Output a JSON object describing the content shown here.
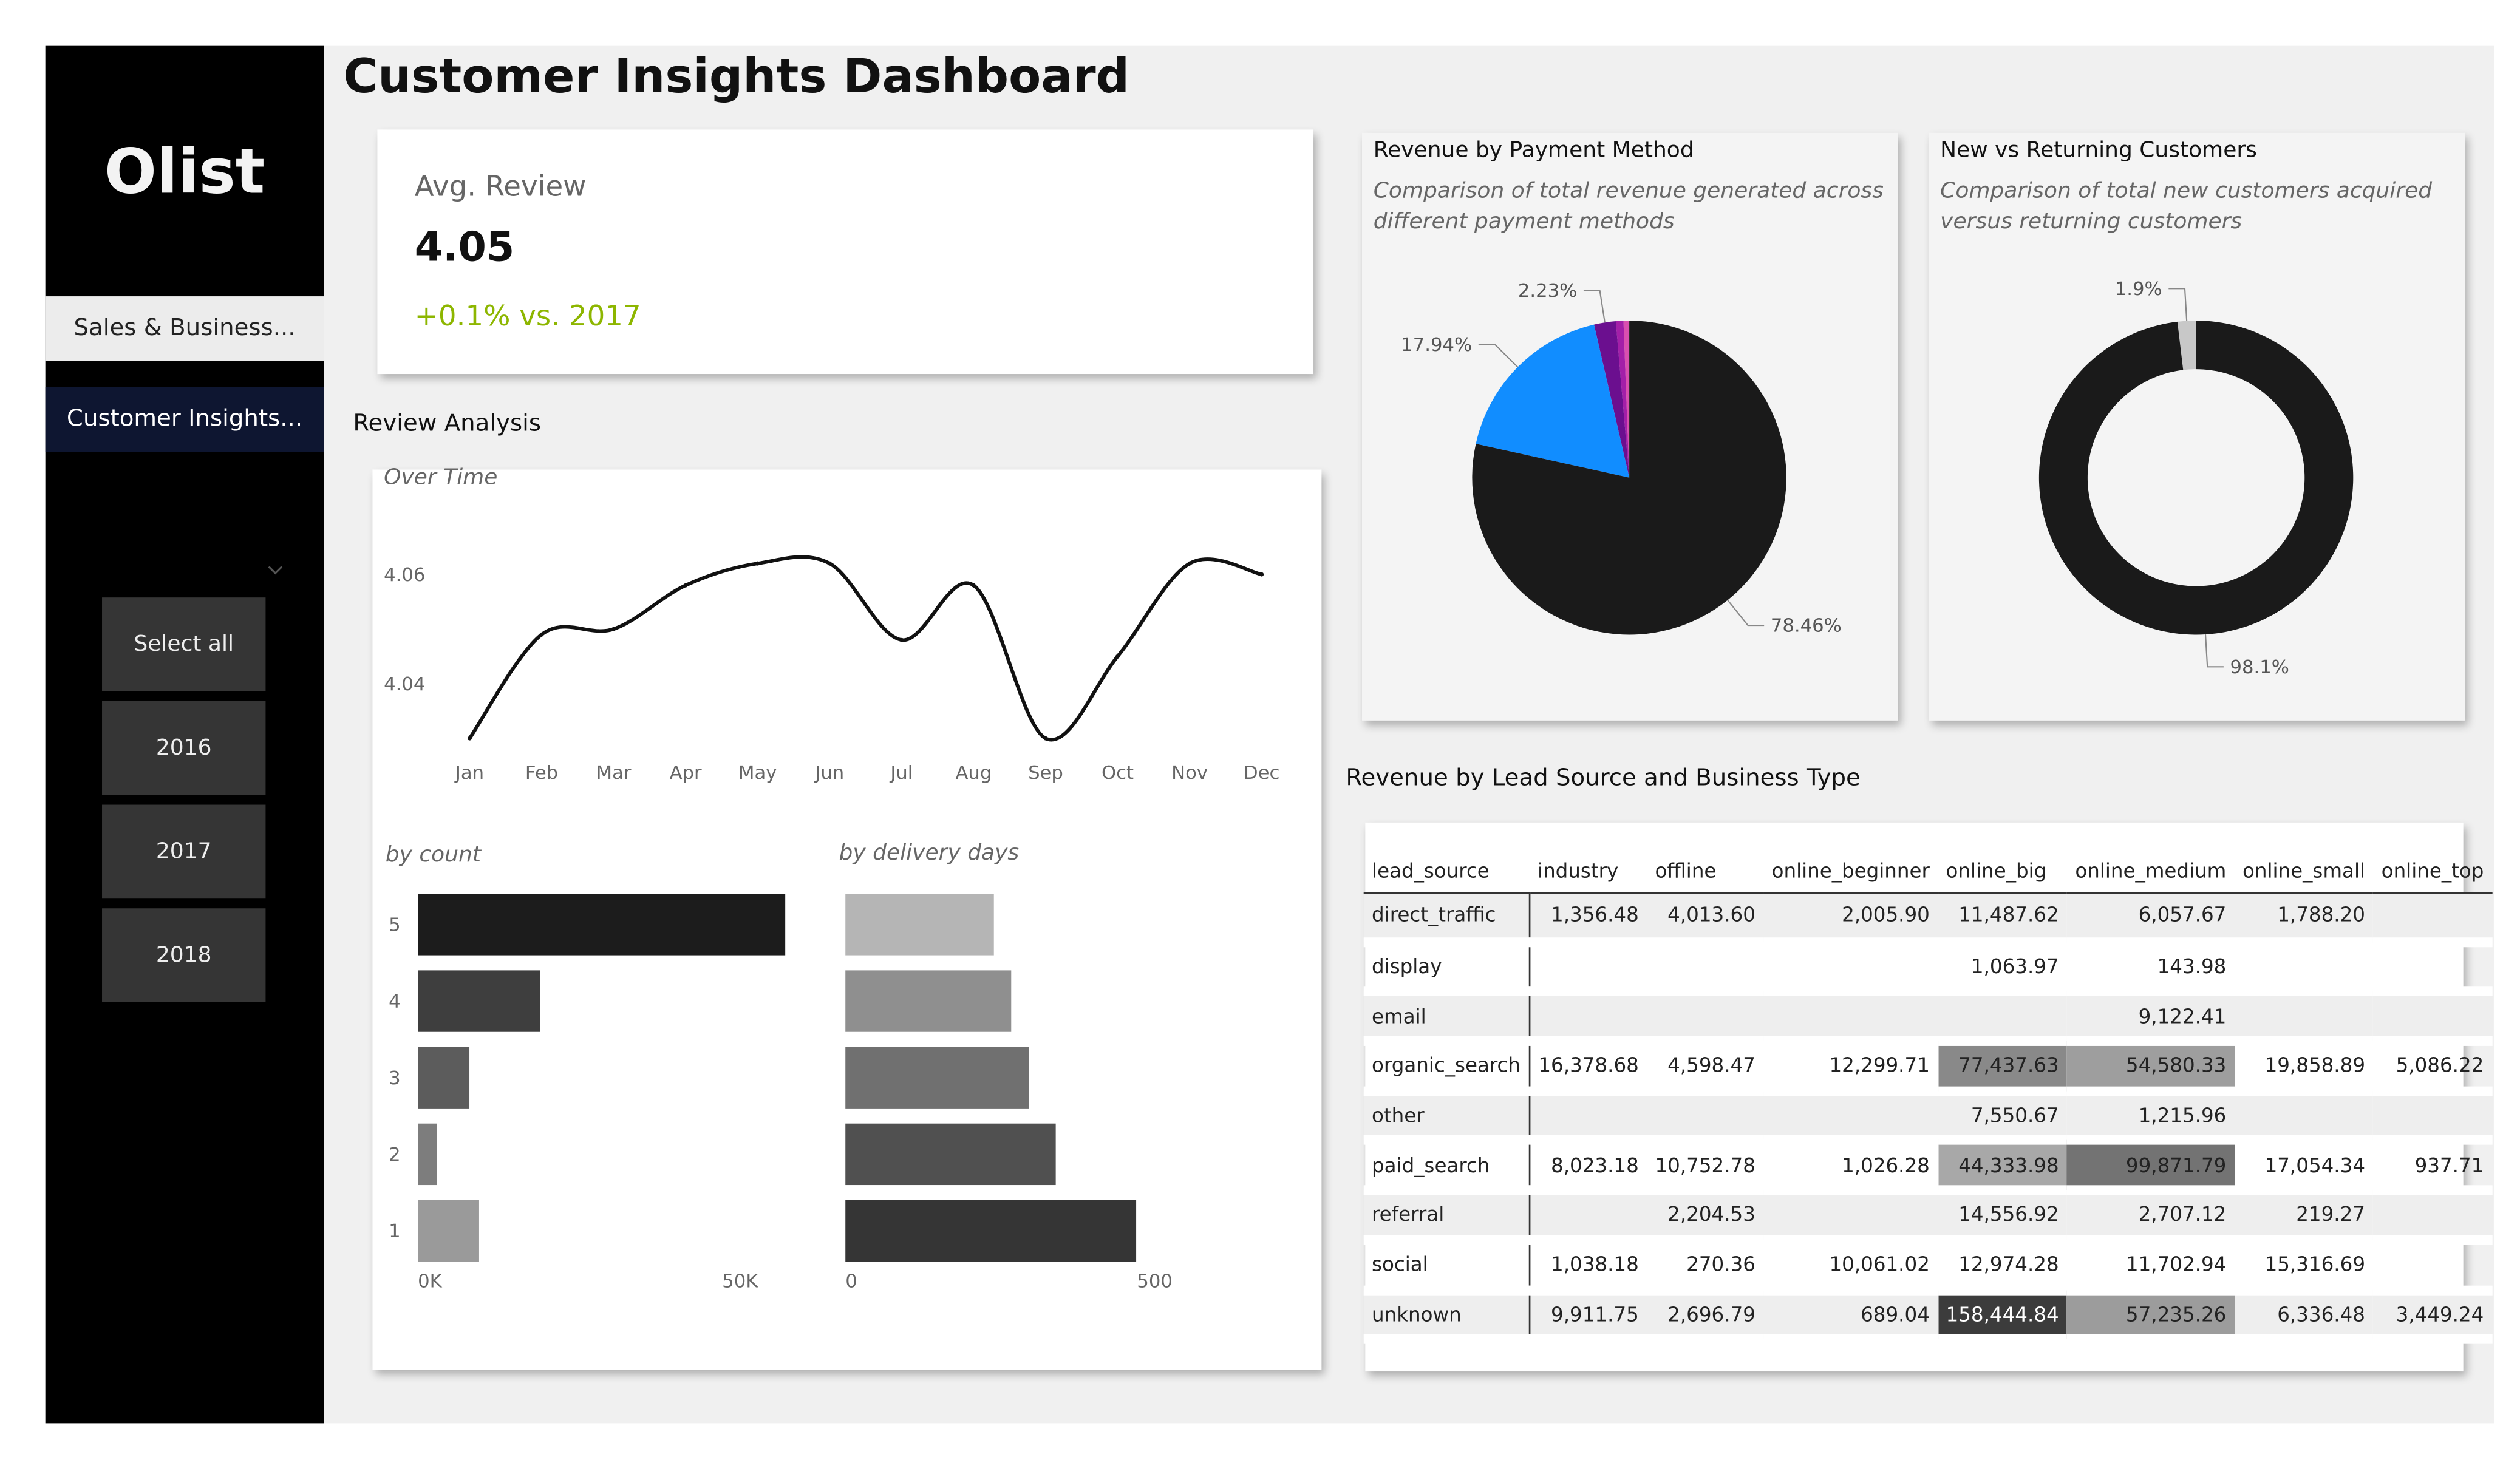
{
  "app": {
    "logo": "Olist",
    "title": "Customer Insights Dashboard",
    "nav": [
      "Sales & Business...",
      "Customer Insights..."
    ]
  },
  "slicer": {
    "options": [
      "Select all",
      "2016",
      "2017",
      "2018"
    ]
  },
  "kpi": {
    "label": "Avg. Review",
    "value": "4.05",
    "delta": "+0.1% vs. 2017",
    "delta_color": "#8db600"
  },
  "review_analysis": {
    "title": "Review Analysis",
    "over_time": {
      "subtitle": "Over Time",
      "chart_data": {
        "type": "line",
        "categories": [
          "Jan",
          "Feb",
          "Mar",
          "Apr",
          "May",
          "Jun",
          "Jul",
          "Aug",
          "Sep",
          "Oct",
          "Nov",
          "Dec"
        ],
        "values": [
          4.03,
          4.049,
          4.05,
          4.058,
          4.062,
          4.062,
          4.048,
          4.058,
          4.03,
          4.045,
          4.062,
          4.06
        ],
        "yticks": [
          "4.04",
          "4.06"
        ],
        "ylim": [
          4.03,
          4.062
        ]
      }
    },
    "by_count": {
      "subtitle": "by count",
      "chart_data": {
        "type": "bar",
        "categories": [
          "5",
          "4",
          "3",
          "2",
          "1"
        ],
        "values": [
          57000,
          19000,
          8000,
          3000,
          9500
        ],
        "colors": [
          "#1c1c1c",
          "#3e3e3e",
          "#5c5c5c",
          "#7d7d7d",
          "#9a9a9a"
        ],
        "xticks": [
          "0K",
          "50K"
        ],
        "xlim": [
          0,
          50000
        ]
      }
    },
    "by_delivery": {
      "subtitle": "by delivery days",
      "chart_data": {
        "type": "bar",
        "categories": [
          "5",
          "4",
          "3",
          "2",
          "1"
        ],
        "values": [
          240,
          268,
          297,
          340,
          470
        ],
        "colors": [
          "#b5b5b5",
          "#8f8f8f",
          "#707070",
          "#505050",
          "#353535"
        ],
        "xticks": [
          "0",
          "500"
        ],
        "xlim": [
          0,
          500
        ]
      }
    }
  },
  "payment": {
    "title": "Revenue by Payment Method",
    "description": "Comparison of total revenue generated across different payment methods",
    "chart_data": {
      "type": "pie",
      "labels": [
        "78.46%",
        "17.94%",
        "2.23%",
        "",
        ""
      ],
      "values": [
        78.46,
        17.94,
        2.23,
        0.78,
        0.59
      ],
      "colors": [
        "#1a1a1a",
        "#118dff",
        "#6b0f8f",
        "#a31fa8",
        "#d94fb0"
      ]
    }
  },
  "customers": {
    "title": "New vs Returning Customers",
    "description": "Comparison of total new customers acquired versus returning customers",
    "chart_data": {
      "type": "donut",
      "labels": [
        "98.1%",
        "1.9%"
      ],
      "values": [
        98.1,
        1.9
      ],
      "colors": [
        "#1a1a1a",
        "#c8c8c8"
      ]
    }
  },
  "matrix": {
    "title": "Revenue by Lead Source and Business Type",
    "columns": [
      "lead_source",
      "industry",
      "offline",
      "online_beginner",
      "online_big",
      "online_medium",
      "online_small",
      "online_top"
    ],
    "rows": [
      [
        "direct_traffic",
        "1,356.48",
        "4,013.60",
        "2,005.90",
        "11,487.62",
        "6,057.67",
        "1,788.20",
        ""
      ],
      [
        "display",
        "",
        "",
        "",
        "1,063.97",
        "143.98",
        "",
        ""
      ],
      [
        "email",
        "",
        "",
        "",
        "",
        "9,122.41",
        "",
        ""
      ],
      [
        "organic_search",
        "16,378.68",
        "4,598.47",
        "12,299.71",
        "77,437.63",
        "54,580.33",
        "19,858.89",
        "5,086.22"
      ],
      [
        "other",
        "",
        "",
        "",
        "7,550.67",
        "1,215.96",
        "",
        ""
      ],
      [
        "paid_search",
        "8,023.18",
        "10,752.78",
        "1,026.28",
        "44,333.98",
        "99,871.79",
        "17,054.34",
        "937.71"
      ],
      [
        "referral",
        "",
        "2,204.53",
        "",
        "14,556.92",
        "2,707.12",
        "219.27",
        ""
      ],
      [
        "social",
        "1,038.18",
        "270.36",
        "10,061.02",
        "12,974.28",
        "11,702.94",
        "15,316.69",
        ""
      ],
      [
        "unknown",
        "9,911.75",
        "2,696.79",
        "689.04",
        "158,444.84",
        "57,235.26",
        "6,336.48",
        "3,449.24"
      ]
    ],
    "heat_max": 158444.84
  }
}
